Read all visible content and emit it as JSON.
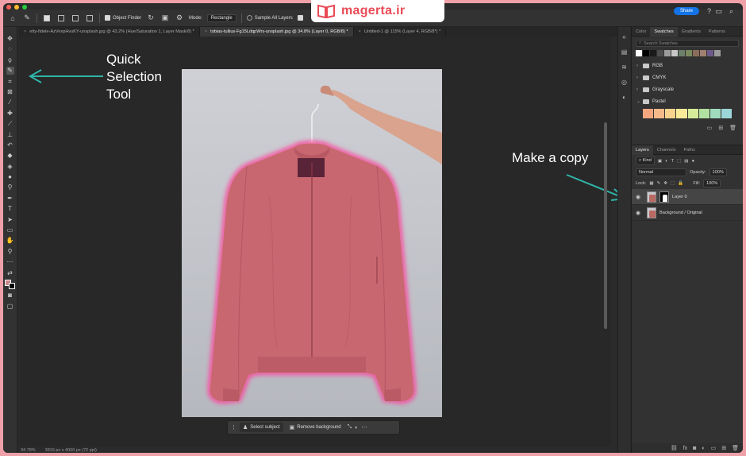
{
  "logo": {
    "text": "magerta.ir",
    "brand_color": "#e94a56"
  },
  "options_bar": {
    "object_finder": "Object Finder",
    "mode_label": "Mode:",
    "mode_value": "Rectangle",
    "sample_all_layers": "Sample All Layers",
    "share": "Share"
  },
  "tabs": [
    {
      "label": "etty-fidele-AzVexpHvuKY-unsplash.jpg @ 43.2% (Hue/Saturation 1, Layer Mask/8) *",
      "active": false
    },
    {
      "label": "tobias-tullius-Fg15LdqpWrs-unsplash.jpg @ 34.8% (Layer 0, RGB/8) *",
      "active": true
    },
    {
      "label": "Untitled-1 @ 115% (Layer 4, RGB/8*) *",
      "active": false
    }
  ],
  "annotations": {
    "quick_selection": [
      "Quick",
      "Selection",
      "Tool"
    ],
    "make_copy": "Make a copy",
    "arrow_color": "#2fb5a8"
  },
  "context_bar": {
    "select_subject": "Select subject",
    "remove_background": "Remove background"
  },
  "status": {
    "zoom": "34.78%",
    "dims": "3816 px x 4000 px (72 ppi)"
  },
  "swatches_panel": {
    "tabs": [
      "Color",
      "Swatches",
      "Gradients",
      "Patterns"
    ],
    "active_tab": "Swatches",
    "search_placeholder": "Search Swatches",
    "recent": [
      "#ffffff",
      "#000000",
      "#1a1a1a",
      "#4d4d4d",
      "#9c9c9c",
      "#c7c7c7",
      "#6b7f6b",
      "#7a8a5f",
      "#8a6d5a",
      "#a08070",
      "#6e5a8a",
      "#9a9a9a"
    ],
    "groups": [
      "RGB",
      "CMYK",
      "Grayscale",
      "Pastel"
    ],
    "pastel": [
      "#f4a77e",
      "#f6b98a",
      "#f9d38e",
      "#fbeb98",
      "#d6ec9a",
      "#b2e0a0",
      "#9fdcbd",
      "#9bd6d8"
    ]
  },
  "layers_panel": {
    "tabs": [
      "Layers",
      "Channels",
      "Paths"
    ],
    "active_tab": "Layers",
    "kind": "Kind",
    "blend_mode": "Normal",
    "opacity_label": "Opacity:",
    "opacity": "100%",
    "lock_label": "Lock:",
    "fill_label": "Fill:",
    "fill": "100%",
    "layers": [
      {
        "name": "Layer 0",
        "active": true,
        "mask": true
      },
      {
        "name": "Background / Original",
        "active": false,
        "mask": false
      }
    ]
  },
  "colors": {
    "jacket": "#c96771",
    "selection_glow": "#ff3e9a",
    "foreground": "#c98585",
    "background": "#000000"
  }
}
